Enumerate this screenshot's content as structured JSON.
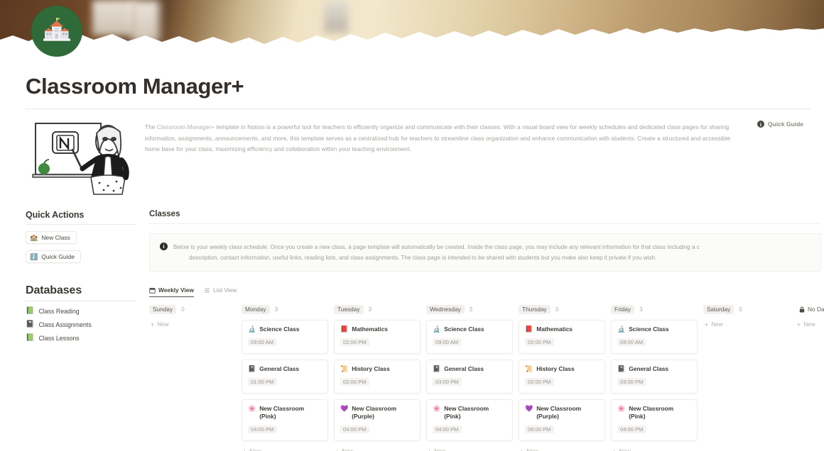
{
  "page": {
    "icon": "school-building-emoji",
    "title": "Classroom Manager+"
  },
  "intro": {
    "text_part1": "The ",
    "highlight": "Classroom Manager+",
    "text_part2": " template in Notion is a powerful tool for teachers to efficiently organize and communicate with their classes. With a visual board view for weekly schedules and dedicated class pages for sharing information, assignments, announcements, and more, this template serves as a centralized hub for teachers to streamline class organization and enhance communication with students. Create a structured and accessible home base for your class, maximizing efficiency and collaboration within your teaching environment.",
    "quick_guide_label": "Quick Guide",
    "quick_guide_icon": "info-icon",
    "illustration": "teacher-at-whiteboard-illustration"
  },
  "sidebar": {
    "quick_actions": {
      "heading": "Quick Actions",
      "buttons": [
        {
          "label": "New Class",
          "icon": "school-building-emoji",
          "glyph": "🏫"
        },
        {
          "label": "Quick Guide",
          "icon": "info-circle-emoji",
          "glyph": "ℹ️"
        }
      ]
    },
    "databases": {
      "heading": "Databases",
      "items": [
        {
          "label": "Class Reading",
          "icon": "green-book-emoji",
          "glyph": "📗"
        },
        {
          "label": "Class Assignments",
          "icon": "notebook-emoji",
          "glyph": "📓"
        },
        {
          "label": "Class Lessons",
          "icon": "open-book-green-emoji",
          "glyph": "📗"
        }
      ]
    }
  },
  "main": {
    "heading": "Classes",
    "callout": {
      "icon": "info-icon",
      "line1": "Below is your weekly class schedule. Once you create a new class, a page template will automatically be created. Inside the class page, you may include any relevant information for that class including a c",
      "line2": "description, contact information, useful links, reading lists, and class assignments. The class page is intended to be shared with students but you make also keep it private if you wish."
    },
    "tabs": [
      {
        "label": "Weekly View",
        "icon": "calendar-icon",
        "active": true
      },
      {
        "label": "List View",
        "icon": "list-icon",
        "active": false
      }
    ],
    "new_label": "New",
    "board": {
      "columns": [
        {
          "name": "Sunday",
          "count": "0",
          "cards": [],
          "show_new_top": true,
          "show_new_bottom": false
        },
        {
          "name": "Monday",
          "count": "3",
          "cards": [
            {
              "title": "Science Class",
              "icon": "microscope-emoji",
              "glyph": "🔬",
              "time": "09:00 AM"
            },
            {
              "title": "General Class",
              "icon": "books-emoji",
              "glyph": "📓",
              "time": "01:00 PM"
            },
            {
              "title": "New Classroom",
              "title2": "(Pink)",
              "icon": "pink-flower-emoji",
              "glyph": "🌸",
              "time": "04:00 PM"
            }
          ],
          "show_new_top": false,
          "show_new_bottom": true
        },
        {
          "name": "Tuesday",
          "count": "3",
          "cards": [
            {
              "title": "Mathematics",
              "icon": "red-book-emoji",
              "glyph": "📕",
              "time": "02:00 PM"
            },
            {
              "title": "History Class",
              "icon": "scroll-emoji",
              "glyph": "📜",
              "time": "02:00 PM"
            },
            {
              "title": "New Classroom",
              "title2": "(Purple)",
              "icon": "purple-flower-emoji",
              "glyph": "💜",
              "time": "04:00 PM"
            }
          ],
          "show_new_top": false,
          "show_new_bottom": true
        },
        {
          "name": "Wednesday",
          "count": "3",
          "cards": [
            {
              "title": "Science Class",
              "icon": "microscope-emoji",
              "glyph": "🔬",
              "time": "09:00 AM"
            },
            {
              "title": "General Class",
              "icon": "books-emoji",
              "glyph": "📓",
              "time": "03:00 PM"
            },
            {
              "title": "New Classroom",
              "title2": "(Pink)",
              "icon": "pink-flower-emoji",
              "glyph": "🌸",
              "time": "04:00 PM"
            }
          ],
          "show_new_top": false,
          "show_new_bottom": true
        },
        {
          "name": "Thursday",
          "count": "3",
          "cards": [
            {
              "title": "Mathematics",
              "icon": "red-book-emoji",
              "glyph": "📕",
              "time": "02:00 PM"
            },
            {
              "title": "History Class",
              "icon": "scroll-emoji",
              "glyph": "📜",
              "time": "02:00 PM"
            },
            {
              "title": "New Classroom",
              "title2": "(Purple)",
              "icon": "purple-flower-emoji",
              "glyph": "💜",
              "time": "06:00 PM"
            }
          ],
          "show_new_top": false,
          "show_new_bottom": true
        },
        {
          "name": "Friday",
          "count": "3",
          "cards": [
            {
              "title": "Science Class",
              "icon": "microscope-emoji",
              "glyph": "🔬",
              "time": "09:00 AM"
            },
            {
              "title": "General Class",
              "icon": "books-emoji",
              "glyph": "📓",
              "time": "03:00 PM"
            },
            {
              "title": "New Classroom",
              "title2": "(Pink)",
              "icon": "pink-flower-emoji",
              "glyph": "🌸",
              "time": "04:00 PM"
            }
          ],
          "show_new_top": false,
          "show_new_bottom": true
        },
        {
          "name": "Saturday",
          "count": "0",
          "cards": [],
          "show_new_top": true,
          "show_new_bottom": false
        },
        {
          "name": "No Date",
          "count": "",
          "icon": "lock-icon",
          "cards": [],
          "show_new_top": true,
          "show_new_bottom": false
        }
      ]
    }
  },
  "colors": {
    "accent_green": "#2f6b3a",
    "text": "#37352f",
    "muted": "#a6a29b",
    "card_border": "#eeedea"
  }
}
